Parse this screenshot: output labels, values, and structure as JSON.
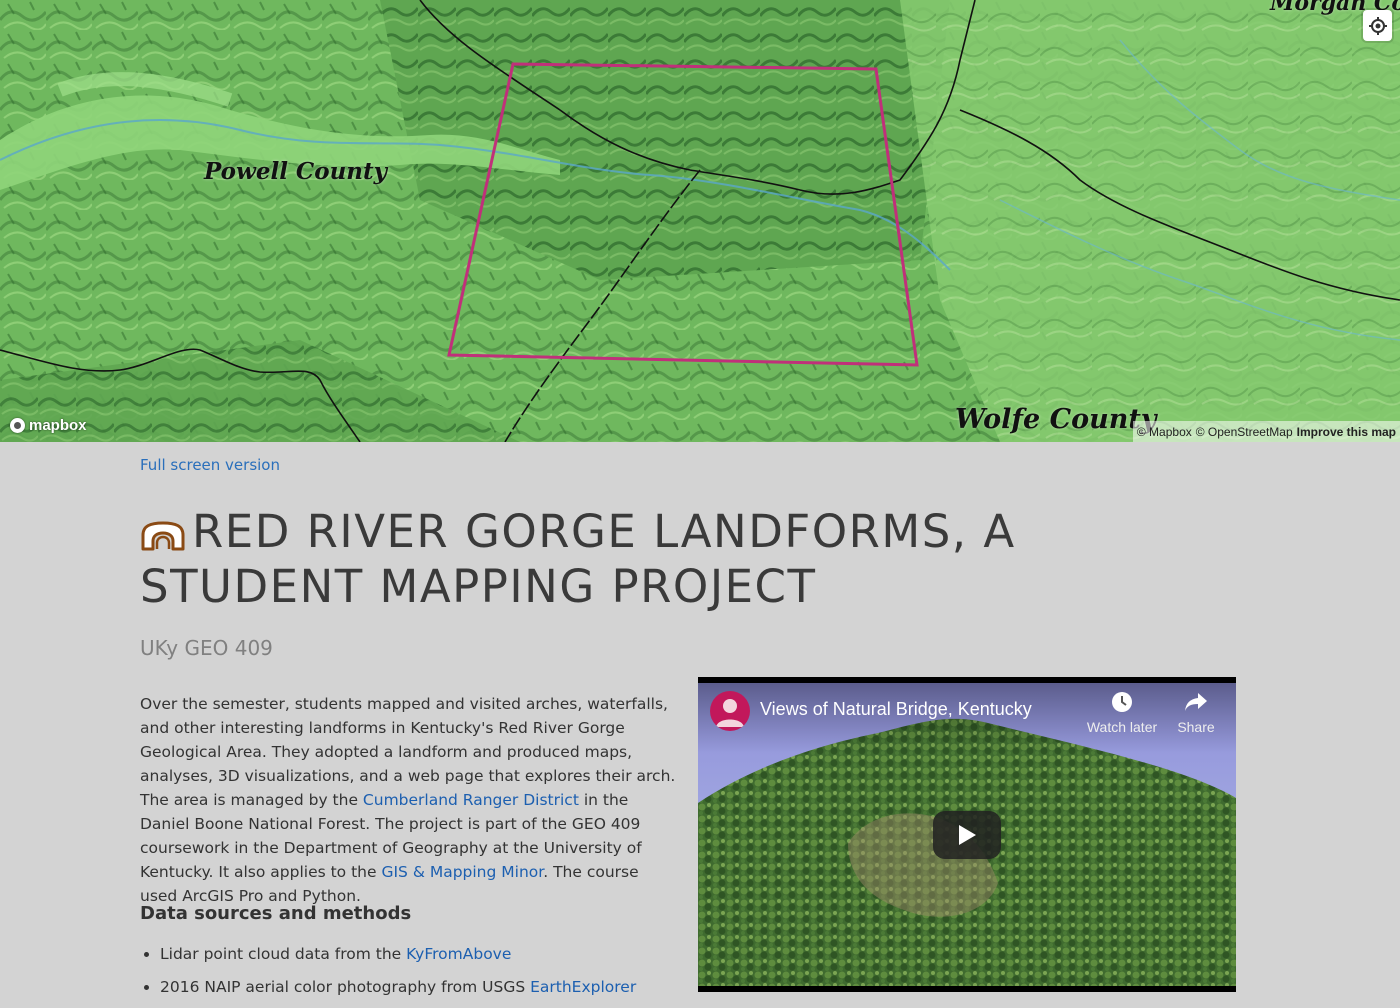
{
  "map": {
    "labels": {
      "powell": "Powell County",
      "wolfe": "Wolfe County",
      "morgan": "Morgan Coun"
    },
    "logo_text": "mapbox",
    "attribution": {
      "mapbox": "© Mapbox",
      "osm": "© OpenStreetMap",
      "improve": "Improve this map"
    },
    "colors": {
      "terrain": "#7cc36a",
      "boundary_box": "#c0307a"
    }
  },
  "page": {
    "fullscreen_link": "Full screen version",
    "title": "RED RIVER GORGE LANDFORMS, A STUDENT MAPPING PROJECT",
    "subtitle": "UKy GEO 409",
    "intro": {
      "p1": "Over the semester, students mapped and visited arches, waterfalls, and other interesting landforms in Kentucky's Red River Gorge Geological Area. They adopted a landform and produced maps, analyses, 3D visualizations, and a web page that explores their arch. The area is managed by the ",
      "link1": "Cumberland Ranger District",
      "p2": " in the Daniel Boone National Forest. The project is part of the GEO 409 coursework in the Department of Geography at the University of Kentucky. It also applies to the ",
      "link2": "GIS & Mapping Minor",
      "p3": ". The course used ArcGIS Pro and Python."
    },
    "section_heading": "Data sources and methods",
    "sources": [
      {
        "text": "Lidar point cloud data from the ",
        "link": "KyFromAbove"
      },
      {
        "text": "2016 NAIP aerial color photography from USGS ",
        "link": "EarthExplorer"
      }
    ]
  },
  "video": {
    "title": "Views of Natural Bridge, Kentucky",
    "watch_later": "Watch later",
    "share": "Share"
  }
}
